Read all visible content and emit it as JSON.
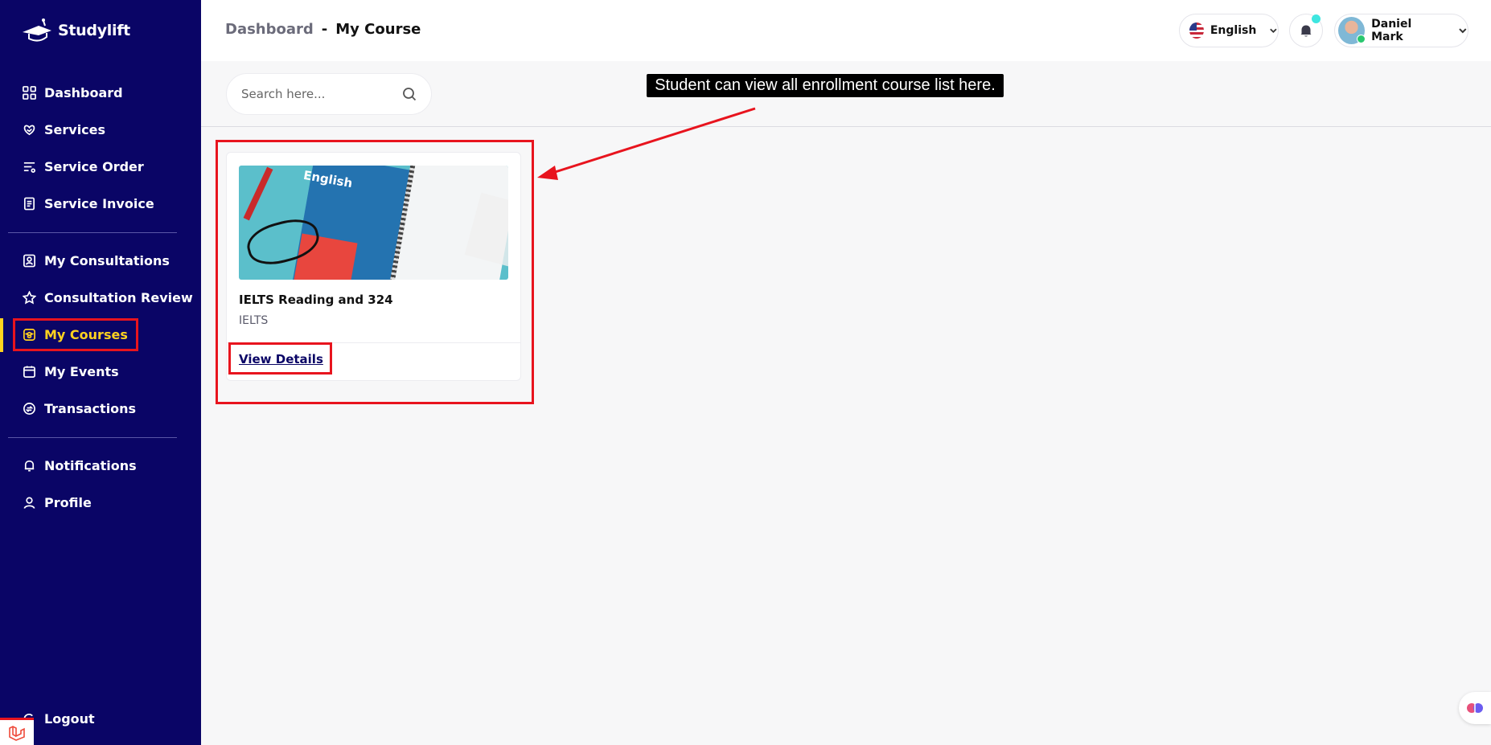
{
  "brand": {
    "name": "Studylift"
  },
  "sidebar": {
    "items": [
      {
        "label": "Dashboard",
        "icon": "grid-icon"
      },
      {
        "label": "Services",
        "icon": "heart-hand-icon"
      },
      {
        "label": "Service Order",
        "icon": "list-filter-icon"
      },
      {
        "label": "Service Invoice",
        "icon": "invoice-icon"
      },
      {
        "label": "My Consultations",
        "icon": "consultation-icon"
      },
      {
        "label": "Consultation Review",
        "icon": "star-icon"
      },
      {
        "label": "My Courses",
        "icon": "graduation-icon",
        "active": true
      },
      {
        "label": "My Events",
        "icon": "calendar-icon"
      },
      {
        "label": "Transactions",
        "icon": "transaction-icon"
      },
      {
        "label": "Notifications",
        "icon": "bell-icon"
      },
      {
        "label": "Profile",
        "icon": "user-icon"
      }
    ],
    "logout_label": "Logout"
  },
  "header": {
    "breadcrumb_parent": "Dashboard",
    "breadcrumb_separator": "-",
    "breadcrumb_current": "My Course",
    "language": "English",
    "user_name": "Daniel Mark"
  },
  "search": {
    "placeholder": "Search here..."
  },
  "callout": {
    "text": "Student can view all enrollment course list here."
  },
  "courses": [
    {
      "title": "IELTS Reading and 324",
      "category": "IELTS",
      "link_label": "View Details",
      "thumb_text": "English"
    }
  ],
  "colors": {
    "sidebar_bg": "#0a0566",
    "active": "#ffd21f",
    "highlight": "#e8141e"
  }
}
